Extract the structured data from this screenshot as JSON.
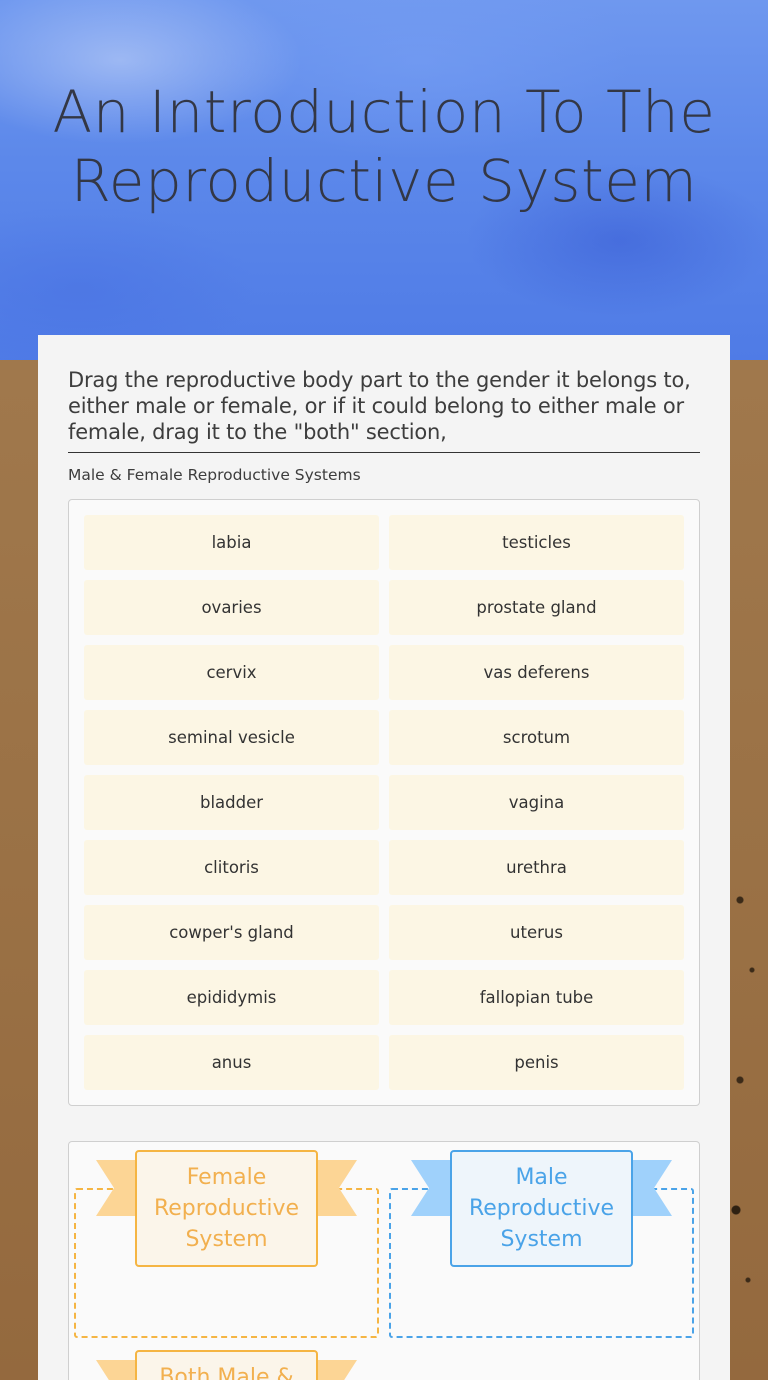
{
  "title": "An Introduction To The Reproductive System",
  "instructions": "Drag the reproductive body part to the gender it belongs to, either male or female, or if it could belong to either male or female, drag it to the \"both\" section,",
  "bank": {
    "label": "Male & Female Reproductive Systems",
    "items": [
      "labia",
      "testicles",
      "ovaries",
      "prostate gland",
      "cervix",
      "vas deferens",
      "seminal vesicle",
      "scrotum",
      "bladder",
      "vagina",
      "clitoris",
      "urethra",
      "cowper's gland",
      "uterus",
      "epididymis",
      "fallopian tube",
      "anus",
      "penis"
    ]
  },
  "zones": {
    "female": {
      "label": "Female Reproductive System",
      "color": "#f5b543"
    },
    "male": {
      "label": "Male Reproductive System",
      "color": "#4aa3e8"
    },
    "both": {
      "label": "Both Male &",
      "color": "#f5b543"
    }
  }
}
